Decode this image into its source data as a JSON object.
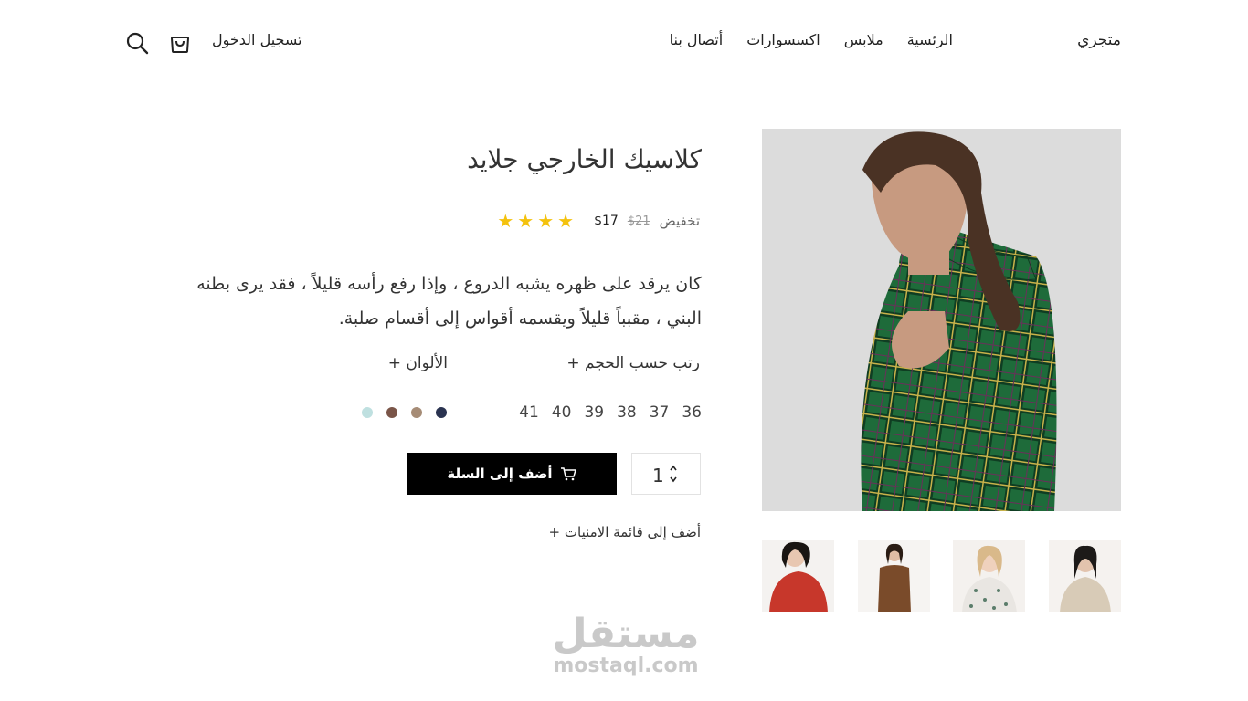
{
  "header": {
    "brand": "متجري",
    "nav": [
      "الرئسية",
      "ملابس",
      "اكسسوارات",
      "أتصال بنا"
    ],
    "login": "تسجيل الدخول"
  },
  "product": {
    "title": "كلاسيك الخارجي جلايد",
    "sale_label": "تخفيض",
    "old_price": "$21",
    "new_price": "$17",
    "rating": 4,
    "description": "كان يرقد على ظهره يشبه الدروع ، وإذا رفع رأسه قليلاً ، فقد يرى بطنه البني ، مقبباً قليلاً ويقسمه أقواس إلى أقسام صلبة.",
    "sort_by_size": "+ رتب حسب الحجم",
    "colors_label": "+ الألوان",
    "sizes": [
      "36",
      "37",
      "38",
      "39",
      "40",
      "41"
    ],
    "colors": [
      "#2a3350",
      "#a68c76",
      "#7a5548",
      "#bfe0e0"
    ],
    "quantity": "1",
    "add_to_cart": "أضف إلى السلة",
    "wishlist": "+ أضف إلى قائمة الامنيات"
  },
  "watermark": {
    "arabic": "مستقل",
    "latin": "mostaql.com"
  }
}
